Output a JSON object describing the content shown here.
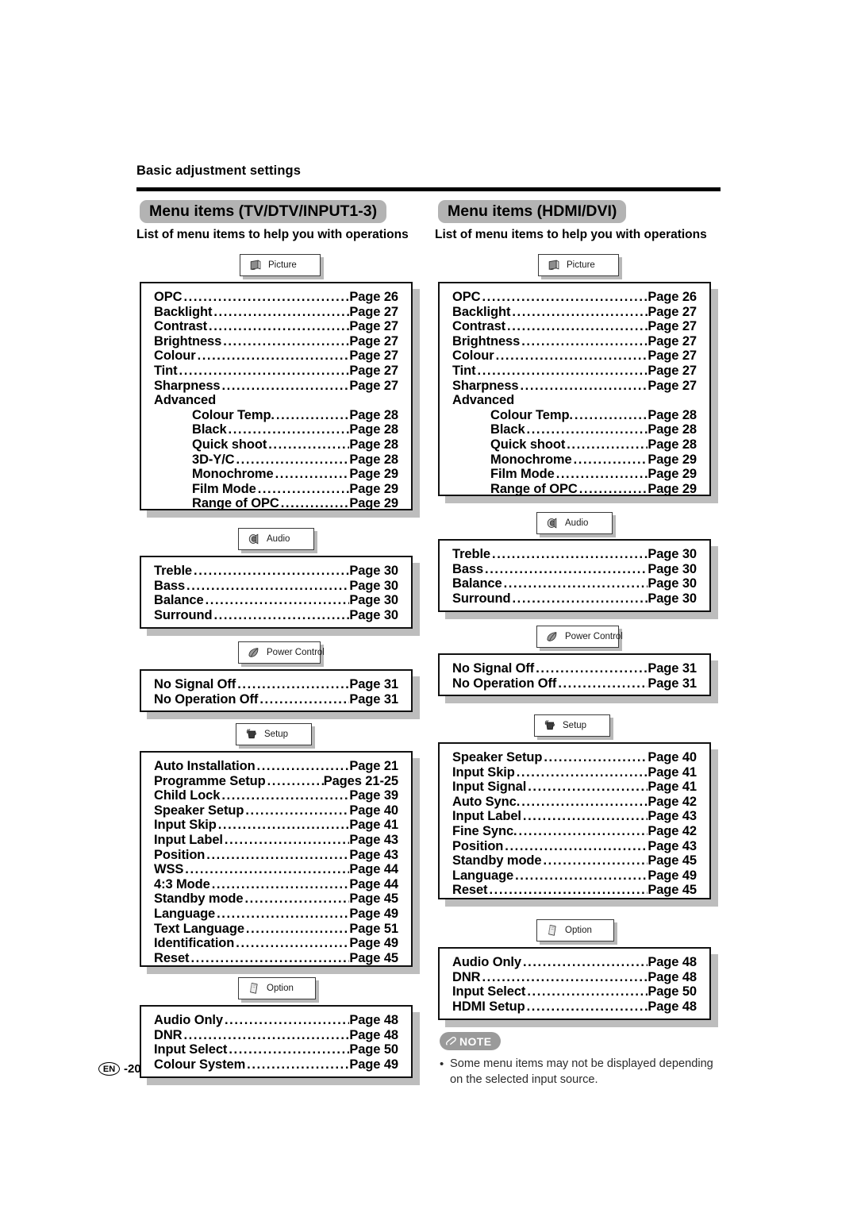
{
  "page": {
    "section_header": "Basic adjustment settings",
    "footer_lang": "EN",
    "footer_page": "-20"
  },
  "columns": [
    {
      "title": "Menu items (TV/DTV/INPUT1-3)",
      "subtitle": "List of menu items to help you with operations",
      "groups": [
        {
          "tab_label": "Picture",
          "tab_icon": "picture-icon",
          "rows": [
            {
              "label": "OPC",
              "page": "Page 26",
              "indent": false,
              "dots": true
            },
            {
              "label": "Backlight",
              "page": "Page 27",
              "indent": false,
              "dots": true
            },
            {
              "label": "Contrast",
              "page": "Page 27",
              "indent": false,
              "dots": true
            },
            {
              "label": "Brightness",
              "page": "Page 27",
              "indent": false,
              "dots": true
            },
            {
              "label": "Colour",
              "page": "Page 27",
              "indent": false,
              "dots": true
            },
            {
              "label": "Tint",
              "page": "Page 27",
              "indent": false,
              "dots": true
            },
            {
              "label": "Sharpness",
              "page": "Page 27",
              "indent": false,
              "dots": true
            },
            {
              "label": "Advanced",
              "page": "",
              "indent": false,
              "dots": false
            },
            {
              "label": "Colour Temp.",
              "page": "Page 28",
              "indent": true,
              "dots": true
            },
            {
              "label": "Black",
              "page": "Page 28",
              "indent": true,
              "dots": true
            },
            {
              "label": "Quick shoot",
              "page": "Page 28",
              "indent": true,
              "dots": true
            },
            {
              "label": "3D-Y/C",
              "page": "Page 28",
              "indent": true,
              "dots": true
            },
            {
              "label": "Monochrome",
              "page": "Page 29",
              "indent": true,
              "dots": true
            },
            {
              "label": "Film Mode",
              "page": "Page 29",
              "indent": true,
              "dots": true
            },
            {
              "label": "Range of OPC",
              "page": "Page 29",
              "indent": true,
              "dots": true
            }
          ]
        },
        {
          "tab_label": "Audio",
          "tab_icon": "speaker-icon",
          "rows": [
            {
              "label": "Treble",
              "page": "Page 30",
              "indent": false,
              "dots": true
            },
            {
              "label": "Bass",
              "page": "Page 30",
              "indent": false,
              "dots": true
            },
            {
              "label": "Balance",
              "page": "Page 30",
              "indent": false,
              "dots": true
            },
            {
              "label": "Surround",
              "page": "Page 30",
              "indent": false,
              "dots": true
            }
          ]
        },
        {
          "tab_label": "Power Control",
          "tab_icon": "leaf-icon",
          "rows": [
            {
              "label": "No Signal Off",
              "page": "Page 31",
              "indent": false,
              "dots": true
            },
            {
              "label": "No Operation Off",
              "page": "Page 31",
              "indent": false,
              "dots": true
            }
          ]
        },
        {
          "tab_label": "Setup",
          "tab_icon": "setup-icon",
          "rows": [
            {
              "label": "Auto Installation",
              "page": "Page 21",
              "indent": false,
              "dots": true
            },
            {
              "label": "Programme Setup",
              "page": "Pages 21-25",
              "indent": false,
              "dots": true
            },
            {
              "label": "Child Lock",
              "page": "Page 39",
              "indent": false,
              "dots": true
            },
            {
              "label": "Speaker Setup",
              "page": "Page 40",
              "indent": false,
              "dots": true
            },
            {
              "label": "Input Skip",
              "page": "Page 41",
              "indent": false,
              "dots": true
            },
            {
              "label": "Input Label",
              "page": "Page 43",
              "indent": false,
              "dots": true
            },
            {
              "label": "Position",
              "page": "Page 43",
              "indent": false,
              "dots": true
            },
            {
              "label": "WSS",
              "page": "Page 44",
              "indent": false,
              "dots": true
            },
            {
              "label": "4:3 Mode",
              "page": "Page 44",
              "indent": false,
              "dots": true
            },
            {
              "label": "Standby mode",
              "page": "Page 45",
              "indent": false,
              "dots": true
            },
            {
              "label": "Language",
              "page": "Page 49",
              "indent": false,
              "dots": true
            },
            {
              "label": "Text Language",
              "page": "Page 51",
              "indent": false,
              "dots": true
            },
            {
              "label": "Identification",
              "page": "Page 49",
              "indent": false,
              "dots": true
            },
            {
              "label": "Reset",
              "page": "Page 45",
              "indent": false,
              "dots": true
            }
          ]
        },
        {
          "tab_label": "Option",
          "tab_icon": "option-icon",
          "rows": [
            {
              "label": "Audio Only",
              "page": "Page 48",
              "indent": false,
              "dots": true
            },
            {
              "label": "DNR",
              "page": "Page 48",
              "indent": false,
              "dots": true
            },
            {
              "label": "Input Select",
              "page": "Page 50",
              "indent": false,
              "dots": true
            },
            {
              "label": "Colour System",
              "page": "Page 49",
              "indent": false,
              "dots": true
            }
          ]
        }
      ]
    },
    {
      "title": "Menu items (HDMI/DVI)",
      "subtitle": "List of menu items to help you with operations",
      "groups": [
        {
          "tab_label": "Picture",
          "tab_icon": "picture-icon",
          "rows": [
            {
              "label": "OPC",
              "page": "Page 26",
              "indent": false,
              "dots": true
            },
            {
              "label": "Backlight",
              "page": "Page 27",
              "indent": false,
              "dots": true
            },
            {
              "label": "Contrast",
              "page": "Page 27",
              "indent": false,
              "dots": true
            },
            {
              "label": "Brightness",
              "page": "Page 27",
              "indent": false,
              "dots": true
            },
            {
              "label": "Colour",
              "page": "Page 27",
              "indent": false,
              "dots": true
            },
            {
              "label": "Tint",
              "page": "Page 27",
              "indent": false,
              "dots": true
            },
            {
              "label": "Sharpness",
              "page": "Page 27",
              "indent": false,
              "dots": true
            },
            {
              "label": "Advanced",
              "page": "",
              "indent": false,
              "dots": false
            },
            {
              "label": "Colour Temp.",
              "page": "Page 28",
              "indent": true,
              "dots": true
            },
            {
              "label": "Black",
              "page": "Page 28",
              "indent": true,
              "dots": true
            },
            {
              "label": "Quick shoot",
              "page": "Page 28",
              "indent": true,
              "dots": true
            },
            {
              "label": "Monochrome",
              "page": "Page 29",
              "indent": true,
              "dots": true
            },
            {
              "label": "Film Mode",
              "page": "Page 29",
              "indent": true,
              "dots": true
            },
            {
              "label": "Range of OPC",
              "page": "Page 29",
              "indent": true,
              "dots": true
            }
          ]
        },
        {
          "tab_label": "Audio",
          "tab_icon": "speaker-icon",
          "rows": [
            {
              "label": "Treble",
              "page": "Page 30",
              "indent": false,
              "dots": true
            },
            {
              "label": "Bass",
              "page": "Page 30",
              "indent": false,
              "dots": true
            },
            {
              "label": "Balance",
              "page": "Page 30",
              "indent": false,
              "dots": true
            },
            {
              "label": "Surround",
              "page": "Page 30",
              "indent": false,
              "dots": true
            }
          ]
        },
        {
          "tab_label": "Power Control",
          "tab_icon": "leaf-icon",
          "rows": [
            {
              "label": "No Signal Off",
              "page": "Page 31",
              "indent": false,
              "dots": true
            },
            {
              "label": "No Operation Off",
              "page": "Page 31",
              "indent": false,
              "dots": true
            }
          ]
        },
        {
          "tab_label": "Setup",
          "tab_icon": "setup-icon",
          "rows": [
            {
              "label": "Speaker Setup",
              "page": "Page 40",
              "indent": false,
              "dots": true
            },
            {
              "label": "Input Skip",
              "page": "Page 41",
              "indent": false,
              "dots": true
            },
            {
              "label": "Input Signal",
              "page": "Page 41",
              "indent": false,
              "dots": true
            },
            {
              "label": "Auto Sync.",
              "page": "Page 42",
              "indent": false,
              "dots": true
            },
            {
              "label": "Input Label",
              "page": "Page 43",
              "indent": false,
              "dots": true
            },
            {
              "label": "Fine Sync.",
              "page": "Page 42",
              "indent": false,
              "dots": true
            },
            {
              "label": "Position",
              "page": "Page 43",
              "indent": false,
              "dots": true
            },
            {
              "label": "Standby mode",
              "page": "Page 45",
              "indent": false,
              "dots": true
            },
            {
              "label": "Language",
              "page": "Page 49",
              "indent": false,
              "dots": true
            },
            {
              "label": "Reset",
              "page": "Page 45",
              "indent": false,
              "dots": true
            }
          ]
        },
        {
          "tab_label": "Option",
          "tab_icon": "option-icon",
          "rows": [
            {
              "label": "Audio Only",
              "page": "Page 48",
              "indent": false,
              "dots": true
            },
            {
              "label": "DNR",
              "page": "Page 48",
              "indent": false,
              "dots": true
            },
            {
              "label": "Input Select",
              "page": "Page 50",
              "indent": false,
              "dots": true
            },
            {
              "label": "HDMI Setup",
              "page": "Page 48",
              "indent": false,
              "dots": true
            }
          ]
        }
      ]
    }
  ],
  "note": {
    "badge_label": "NOTE",
    "bullet": "•",
    "text": "Some menu items may not be displayed depending on the selected input source."
  },
  "colors": {
    "title_bg": "#b3b3b3",
    "box_border": "#111111",
    "box_shadow": "#bdbdbd",
    "note_badge_bg": "#9a9a9a"
  }
}
